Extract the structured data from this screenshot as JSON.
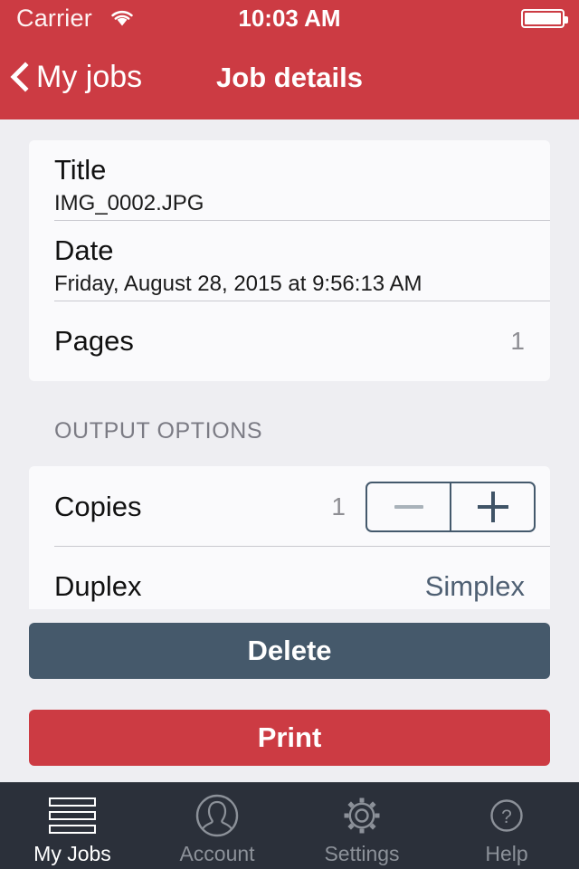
{
  "status_bar": {
    "carrier": "Carrier",
    "time": "10:03 AM",
    "wifi_icon": "wifi-icon",
    "battery_icon": "battery-icon",
    "battery_level_percent": 92
  },
  "nav_bar": {
    "back_label": "My jobs",
    "back_icon": "chevron-left-icon",
    "title": "Job details",
    "background_color": "#cc3b43"
  },
  "info_section": {
    "rows": [
      {
        "label": "Title",
        "value": "IMG_0002.JPG"
      },
      {
        "label": "Date",
        "value": "Friday, August 28, 2015 at 9:56:13 AM"
      },
      {
        "label": "Pages",
        "value": "1"
      }
    ]
  },
  "output_options": {
    "header": "OUTPUT OPTIONS",
    "copies": {
      "label": "Copies",
      "value": "1",
      "decrement_icon": "minus-icon",
      "increment_icon": "plus-icon",
      "decrement_enabled": false
    },
    "duplex": {
      "label": "Duplex",
      "value": "Simplex"
    }
  },
  "actions": {
    "delete_label": "Delete",
    "delete_color": "#45596b",
    "print_label": "Print",
    "print_color": "#cc3b43"
  },
  "tab_bar": {
    "background_color": "#2b303a",
    "active_color": "#ffffff",
    "inactive_color": "#8c9199",
    "tabs": [
      {
        "label": "My Jobs",
        "icon": "list-bars-icon",
        "active": true
      },
      {
        "label": "Account",
        "icon": "person-circle-icon",
        "active": false
      },
      {
        "label": "Settings",
        "icon": "gear-icon",
        "active": false
      },
      {
        "label": "Help",
        "icon": "question-circle-icon",
        "active": false
      }
    ]
  }
}
